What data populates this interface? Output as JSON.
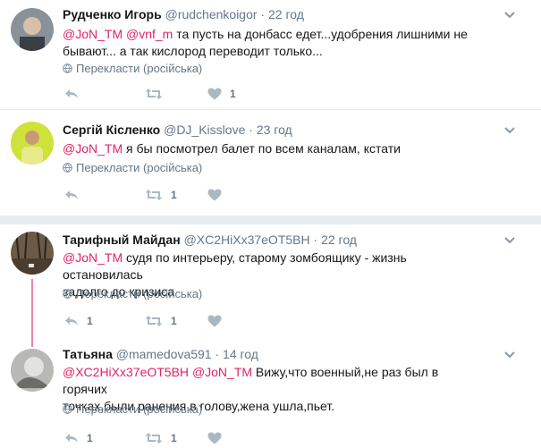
{
  "translate_label": "Перекласти (російська)",
  "tweets": [
    {
      "name": "Рудченко Игорь",
      "handle": "@rudchenkoigor",
      "dot": "·",
      "time": "22 год",
      "mentions": [
        "@JoN_TM",
        "@vnf_m"
      ],
      "text_1": " та пусть на донбасс едет...удобрения лишними не",
      "text_2": "бывают... а так кислород переводит только...",
      "retweets": "",
      "likes": "1"
    },
    {
      "name": "Сергій Кісленко",
      "handle": "@DJ_Kisslove",
      "dot": "·",
      "time": "23 год",
      "mentions": [
        "@JoN_TM"
      ],
      "text_1": " я бы посмотрел балет по всем каналам, кстати",
      "retweets": "1",
      "likes": ""
    },
    {
      "name": "Тарифный Майдан",
      "handle": "@XC2HiXx37eOT5BH",
      "dot": "·",
      "time": "22 год",
      "mentions": [
        "@JoN_TM"
      ],
      "text_1": " судя по интерьеру, старому зомбоящику - жизнь остановилась",
      "text_2": "задолго до кризиса",
      "replies": "1",
      "retweets": "1",
      "likes": ""
    },
    {
      "name": "Татьяна",
      "handle": "@mamedova591",
      "dot": "·",
      "time": "14 год",
      "mentions": [
        "@XC2HiXx37eOT5BH",
        "@JoN_TM"
      ],
      "text_1": " Вижу,что военный,не раз был в горячих",
      "text_2": "точках,были ранения в голову,жена ушла,пьет.",
      "replies": "1",
      "retweets": "1",
      "likes": ""
    }
  ]
}
